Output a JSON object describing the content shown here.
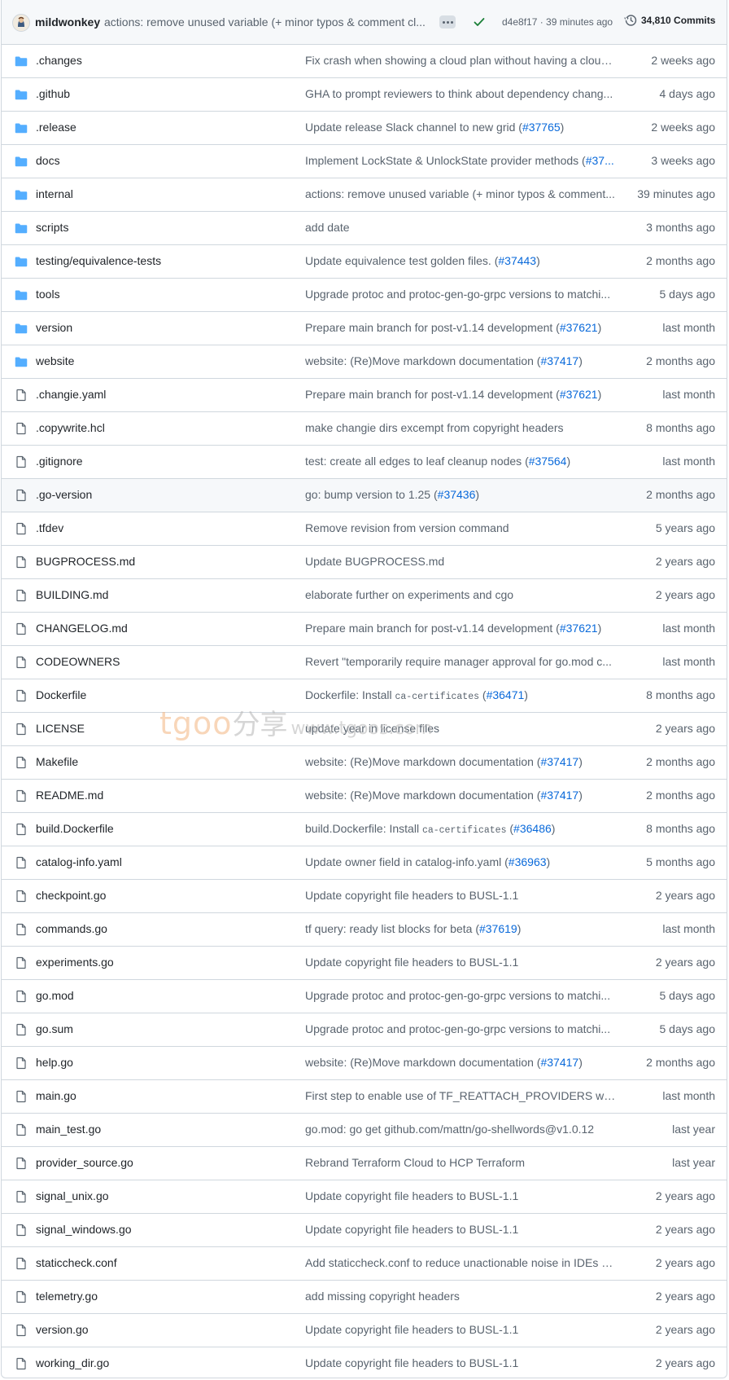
{
  "header": {
    "author": "mildwonkey",
    "commit_message": "actions: remove unused variable (+ minor typos & comment cl...",
    "commit_sha_time": "d4e8f17 · 39 minutes ago",
    "commits_count": "34,810 Commits",
    "status": "success"
  },
  "colors": {
    "folder": "#54aeff",
    "link": "#0969da",
    "muted": "#59636e",
    "border": "#d0d7de",
    "success": "#1a7f37"
  },
  "files": [
    {
      "type": "folder",
      "name": ".changes",
      "msg": "Fix crash when showing a cloud plan without having a cloud ...",
      "age": "2 weeks ago"
    },
    {
      "type": "folder",
      "name": ".github",
      "msg": "GHA to prompt reviewers to think about dependency chang...",
      "age": "4 days ago"
    },
    {
      "type": "folder",
      "name": ".release",
      "msg": "Update release Slack channel to new grid (",
      "pr": "#37765",
      "msg_end": ")",
      "age": "2 weeks ago"
    },
    {
      "type": "folder",
      "name": "docs",
      "msg": "Implement LockState & UnlockState provider methods (",
      "pr": "#37...",
      "age": "3 weeks ago"
    },
    {
      "type": "folder",
      "name": "internal",
      "msg": "actions: remove unused variable (+ minor typos & comment...",
      "age": "39 minutes ago"
    },
    {
      "type": "folder",
      "name": "scripts",
      "msg": "add date",
      "age": "3 months ago"
    },
    {
      "type": "folder",
      "name": "testing/equivalence-tests",
      "msg": "Update equivalence test golden files. (",
      "pr": "#37443",
      "msg_end": ")",
      "age": "2 months ago"
    },
    {
      "type": "folder",
      "name": "tools",
      "msg": "Upgrade protoc and protoc-gen-go-grpc versions to matchi...",
      "age": "5 days ago"
    },
    {
      "type": "folder",
      "name": "version",
      "msg": "Prepare main branch for post-v1.14 development (",
      "pr": "#37621",
      "msg_end": ")",
      "age": "last month"
    },
    {
      "type": "folder",
      "name": "website",
      "msg": "website: (Re)Move markdown documentation (",
      "pr": "#37417",
      "msg_end": ")",
      "age": "2 months ago"
    },
    {
      "type": "file",
      "name": ".changie.yaml",
      "msg": "Prepare main branch for post-v1.14 development (",
      "pr": "#37621",
      "msg_end": ")",
      "age": "last month"
    },
    {
      "type": "file",
      "name": ".copywrite.hcl",
      "msg": "make changie dirs excempt from copyright headers",
      "age": "8 months ago"
    },
    {
      "type": "file",
      "name": ".gitignore",
      "msg": "test: create all edges to leaf cleanup nodes (",
      "pr": "#37564",
      "msg_end": ")",
      "age": "last month"
    },
    {
      "type": "file",
      "name": ".go-version",
      "msg": "go: bump version to 1.25 (",
      "pr": "#37436",
      "msg_end": ")",
      "age": "2 months ago",
      "highlight": true
    },
    {
      "type": "file",
      "name": ".tfdev",
      "msg": "Remove revision from version command",
      "age": "5 years ago"
    },
    {
      "type": "file",
      "name": "BUGPROCESS.md",
      "msg": "Update BUGPROCESS.md",
      "age": "2 years ago"
    },
    {
      "type": "file",
      "name": "BUILDING.md",
      "msg": "elaborate further on experiments and cgo",
      "age": "2 years ago"
    },
    {
      "type": "file",
      "name": "CHANGELOG.md",
      "msg": "Prepare main branch for post-v1.14 development (",
      "pr": "#37621",
      "msg_end": ")",
      "age": "last month"
    },
    {
      "type": "file",
      "name": "CODEOWNERS",
      "msg": "Revert \"temporarily require manager approval for go.mod c...",
      "age": "last month"
    },
    {
      "type": "file",
      "name": "Dockerfile",
      "msg": "Dockerfile: Install ",
      "code": "ca-certificates",
      "msg_mid": " (",
      "pr": "#36471",
      "msg_end": ")",
      "age": "8 months ago"
    },
    {
      "type": "file",
      "name": "LICENSE",
      "msg": "update year in license files",
      "age": "2 years ago"
    },
    {
      "type": "file",
      "name": "Makefile",
      "msg": "website: (Re)Move markdown documentation (",
      "pr": "#37417",
      "msg_end": ")",
      "age": "2 months ago"
    },
    {
      "type": "file",
      "name": "README.md",
      "msg": "website: (Re)Move markdown documentation (",
      "pr": "#37417",
      "msg_end": ")",
      "age": "2 months ago"
    },
    {
      "type": "file",
      "name": "build.Dockerfile",
      "msg": "build.Dockerfile: Install ",
      "code": "ca-certificates",
      "msg_mid": " (",
      "pr": "#36486",
      "msg_end": ")",
      "age": "8 months ago"
    },
    {
      "type": "file",
      "name": "catalog-info.yaml",
      "msg": "Update owner field in catalog-info.yaml (",
      "pr": "#36963",
      "msg_end": ")",
      "age": "5 months ago"
    },
    {
      "type": "file",
      "name": "checkpoint.go",
      "msg": "Update copyright file headers to BUSL-1.1",
      "age": "2 years ago"
    },
    {
      "type": "file",
      "name": "commands.go",
      "msg": "tf query: ready list blocks for beta (",
      "pr": "#37619",
      "msg_end": ")",
      "age": "last month"
    },
    {
      "type": "file",
      "name": "experiments.go",
      "msg": "Update copyright file headers to BUSL-1.1",
      "age": "2 years ago"
    },
    {
      "type": "file",
      "name": "go.mod",
      "msg": "Upgrade protoc and protoc-gen-go-grpc versions to matchi...",
      "age": "5 days ago"
    },
    {
      "type": "file",
      "name": "go.sum",
      "msg": "Upgrade protoc and protoc-gen-go-grpc versions to matchi...",
      "age": "5 days ago"
    },
    {
      "type": "file",
      "name": "help.go",
      "msg": "website: (Re)Move markdown documentation (",
      "pr": "#37417",
      "msg_end": ")",
      "age": "2 months ago"
    },
    {
      "type": "file",
      "name": "main.go",
      "msg": "First step to enable use of TF_REATTACH_PROVIDERS with P...",
      "age": "last month"
    },
    {
      "type": "file",
      "name": "main_test.go",
      "msg": "go.mod: go get github.com/mattn/go-shellwords@v1.0.12",
      "age": "last year"
    },
    {
      "type": "file",
      "name": "provider_source.go",
      "msg": "Rebrand Terraform Cloud to HCP Terraform",
      "age": "last year"
    },
    {
      "type": "file",
      "name": "signal_unix.go",
      "msg": "Update copyright file headers to BUSL-1.1",
      "age": "2 years ago"
    },
    {
      "type": "file",
      "name": "signal_windows.go",
      "msg": "Update copyright file headers to BUSL-1.1",
      "age": "2 years ago"
    },
    {
      "type": "file",
      "name": "staticcheck.conf",
      "msg": "Add staticcheck.conf to reduce unactionable noise in IDEs (",
      "pr": "#...",
      "age": "2 years ago"
    },
    {
      "type": "file",
      "name": "telemetry.go",
      "msg": "add missing copyright headers",
      "age": "2 years ago"
    },
    {
      "type": "file",
      "name": "version.go",
      "msg": "Update copyright file headers to BUSL-1.1",
      "age": "2 years ago"
    },
    {
      "type": "file",
      "name": "working_dir.go",
      "msg": "Update copyright file headers to BUSL-1.1",
      "age": "2 years ago"
    }
  ],
  "watermark": {
    "brand": "tgoo",
    "cn": "分享",
    "url": "www.tgoos.com"
  }
}
